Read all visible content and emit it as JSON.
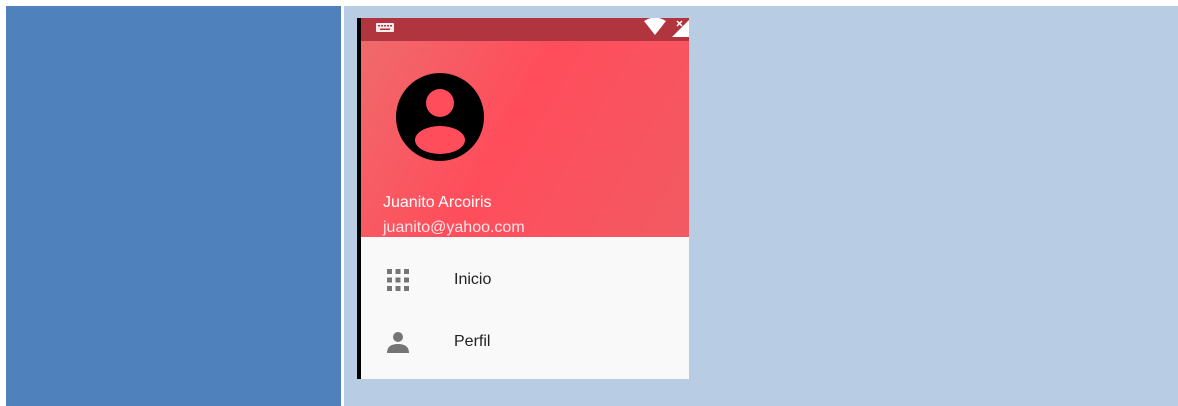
{
  "colors": {
    "left_cell": "#4f81bd",
    "right_cell": "#b8cce4",
    "status_bar": "#b0353f",
    "header_accent": "#ff4d5c",
    "menu_background": "#f9f9f9"
  },
  "status_bar": {
    "icons": [
      "keyboard-icon",
      "wifi-icon",
      "signal-icon"
    ]
  },
  "drawer_header": {
    "avatar_icon": "account-circle-icon",
    "user_name": "Juanito Arcoiris",
    "user_email": "juanito@yahoo.com"
  },
  "menu": {
    "items": [
      {
        "label": "Inicio",
        "icon": "grid-icon"
      },
      {
        "label": "Perfil",
        "icon": "person-icon"
      }
    ]
  }
}
